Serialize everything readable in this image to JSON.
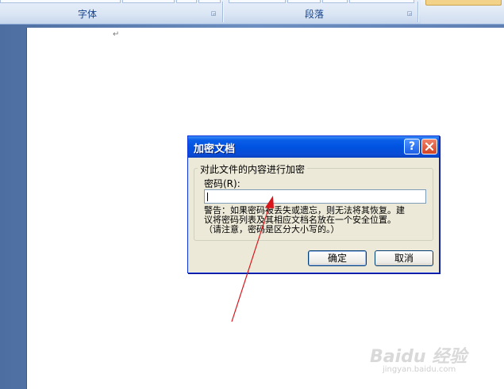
{
  "ribbon": {
    "groups": [
      {
        "label": "字体"
      },
      {
        "label": "段落"
      }
    ],
    "launcher_icon": "dialog-launcher-icon"
  },
  "document": {
    "paragraph_mark": "↵"
  },
  "dialog": {
    "title": "加密文档",
    "help_label": "?",
    "close_label": "✕",
    "group_title": "对此文件的内容进行加密",
    "password_label": "密码(R):",
    "password_value": "",
    "warning_line1": "警告：如果密码被丢失或遗忘，则无法将其恢复。建",
    "warning_line2": "议将密码列表及其相应文档名放在一个安全位置。",
    "warning_line3": "（请注意，密码是区分大小写的。）",
    "ok_label": "确定",
    "cancel_label": "取消"
  },
  "annotation": {
    "color": "#d9161c"
  },
  "watermark": {
    "logo": "Baidu 经验",
    "url": "jingyan.baidu.com"
  }
}
